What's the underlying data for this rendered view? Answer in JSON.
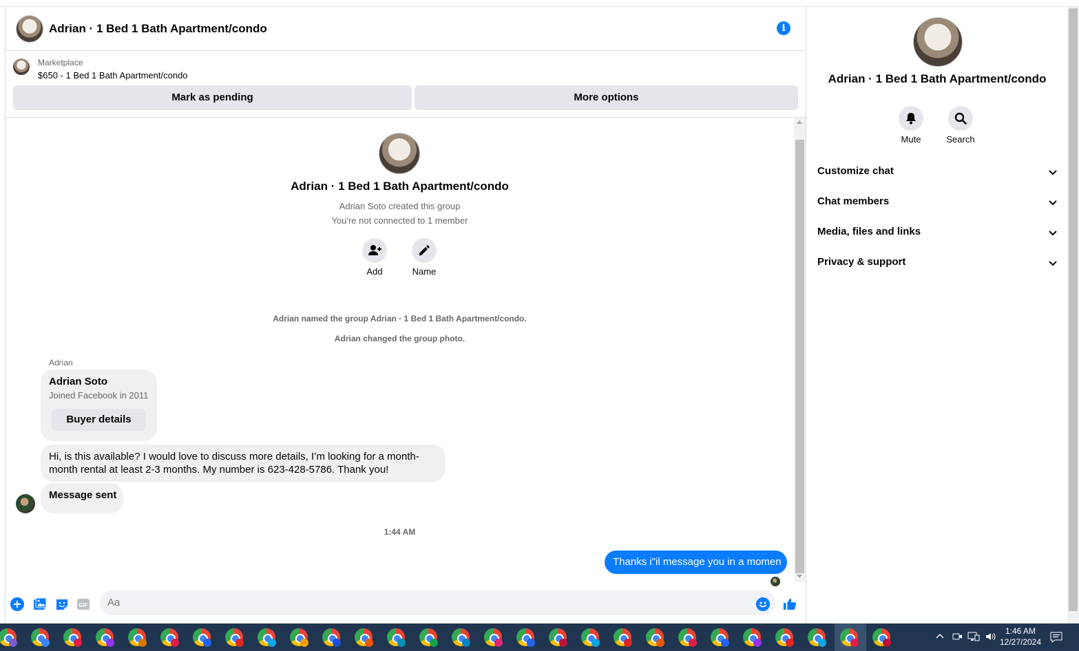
{
  "header": {
    "title": "Adrian · 1 Bed 1 Bath Apartment/condo"
  },
  "marketplace": {
    "label": "Marketplace",
    "listing": "$650 - 1 Bed 1 Bath Apartment/condo",
    "mark_pending": "Mark as pending",
    "more_options": "More options"
  },
  "intro": {
    "title": "Adrian · 1 Bed 1 Bath Apartment/condo",
    "created": "Adrian Soto created this group",
    "not_connected": "You're not connected to 1 member",
    "add_label": "Add",
    "name_label": "Name"
  },
  "system_messages": [
    "Adrian named the group Adrian · 1 Bed 1 Bath Apartment/condo.",
    "Adrian changed the group photo."
  ],
  "incoming": {
    "sender": "Adrian",
    "card_name": "Adrian Soto",
    "card_sub": "Joined Facebook in 2011",
    "buyer_details": "Buyer details",
    "message_line1": "Hi, is this available? I would love to discuss more details, I’m looking for a month-",
    "message_line2": "month rental at least 2-3 months. My number is 623-428-5786. Thank you!",
    "message_sent": "Message sent"
  },
  "timestamp": "1:44 AM",
  "outgoing": {
    "text": "Thanks i\"il message you in a momen"
  },
  "composer": {
    "placeholder": "Aa"
  },
  "sidebar": {
    "title": "Adrian · 1 Bed 1 Bath Apartment/condo",
    "mute": "Mute",
    "search": "Search",
    "sections": [
      "Customize chat",
      "Chat members",
      "Media, files and links",
      "Privacy & support"
    ]
  },
  "taskbar": {
    "time": "1:46 AM",
    "date": "12/27/2024"
  },
  "colors": {
    "accent": "#0a7cff",
    "bubble_grey": "#f0f0f0",
    "button_grey": "#e4e6eb",
    "taskbar": "#1f3550"
  }
}
